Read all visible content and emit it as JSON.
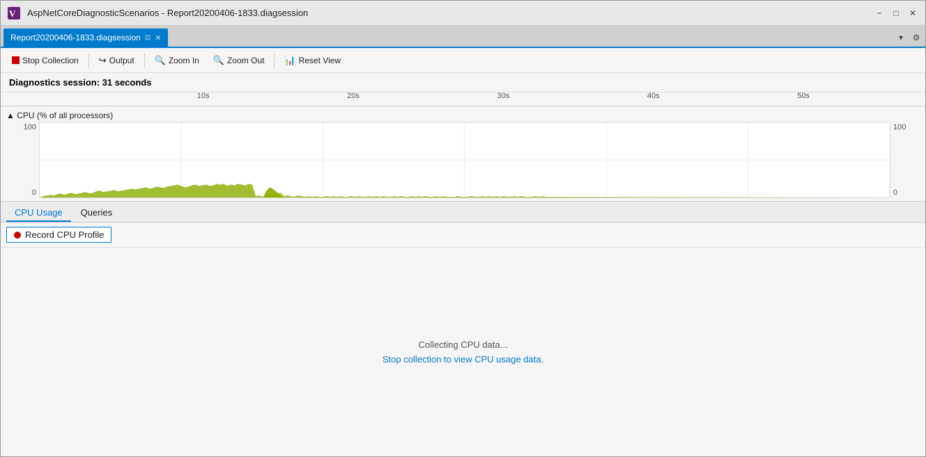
{
  "titleBar": {
    "logo": "vs-icon",
    "title": "AspNetCoreDiagnosticScenarios - Report20200406-1833.diagsession",
    "minimize": "−",
    "maximize": "□",
    "close": "✕"
  },
  "tabBar": {
    "tab": {
      "label": "Report20200406-1833.diagsession",
      "pin": "⊡",
      "close": "✕"
    },
    "dropdownArrow": "▾",
    "gear": "⚙"
  },
  "toolbar": {
    "stopCollection": "Stop Collection",
    "output": "Output",
    "zoomIn": "Zoom In",
    "zoomOut": "Zoom Out",
    "resetView": "Reset View"
  },
  "diagHeader": {
    "text": "Diagnostics session: 31 seconds"
  },
  "timeline": {
    "marks": [
      "10s",
      "20s",
      "30s",
      "40s",
      "50s"
    ]
  },
  "cpuChart": {
    "title": "▲ CPU (% of all processors)",
    "yAxisMax": "100",
    "yAxisMin": "0",
    "yAxisMaxRight": "100",
    "yAxisMinRight": "0"
  },
  "bottomPanel": {
    "tabs": [
      {
        "label": "CPU Usage",
        "active": true
      },
      {
        "label": "Queries",
        "active": false
      }
    ],
    "recordCPUButton": "Record CPU Profile",
    "collectingMessage": "Collecting CPU data...",
    "stopMessage": "Stop collection to view CPU usage data."
  }
}
